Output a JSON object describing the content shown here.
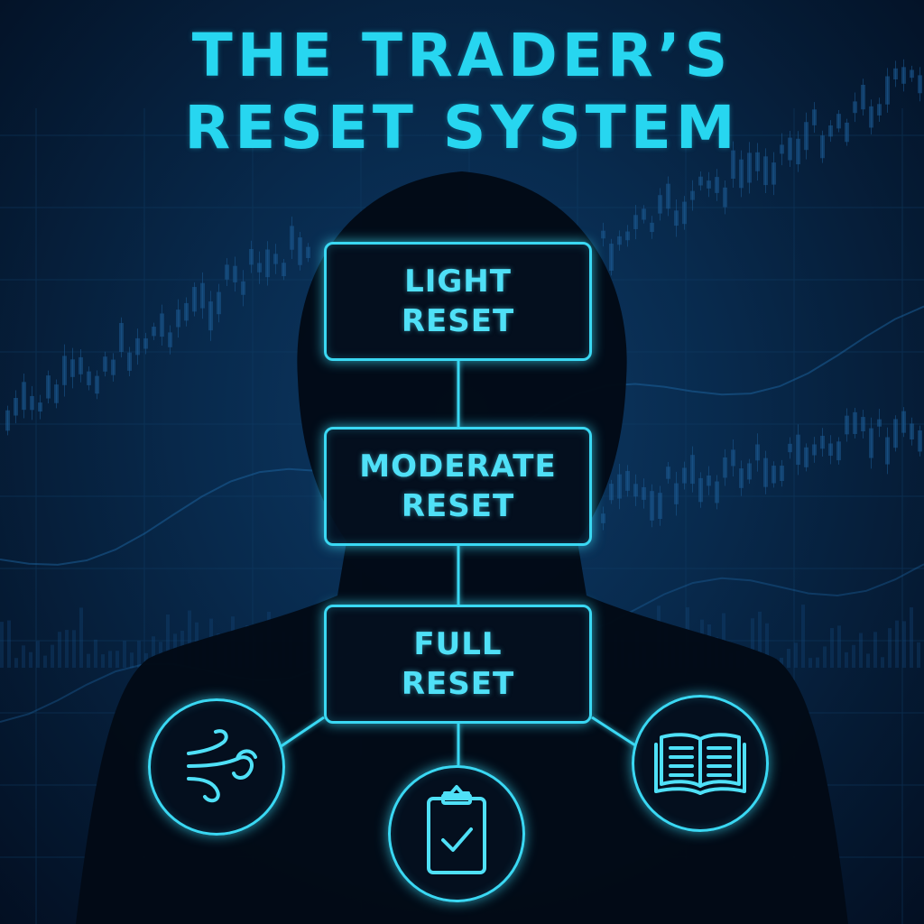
{
  "title": {
    "line1": "THE TRADER’S",
    "line2": "RESET SYSTEM"
  },
  "stages": [
    {
      "line1": "LIGHT",
      "line2": "RESET"
    },
    {
      "line1": "MODERATE",
      "line2": "RESET"
    },
    {
      "line1": "FULL",
      "line2": "RESET"
    }
  ],
  "icons": [
    "breathing-wind-icon",
    "checklist-clipboard-icon",
    "open-book-icon"
  ],
  "colors": {
    "accent": "#27d6f0",
    "box_border": "#3ad8f3",
    "background": "#061a33",
    "silhouette": "#020a16"
  }
}
